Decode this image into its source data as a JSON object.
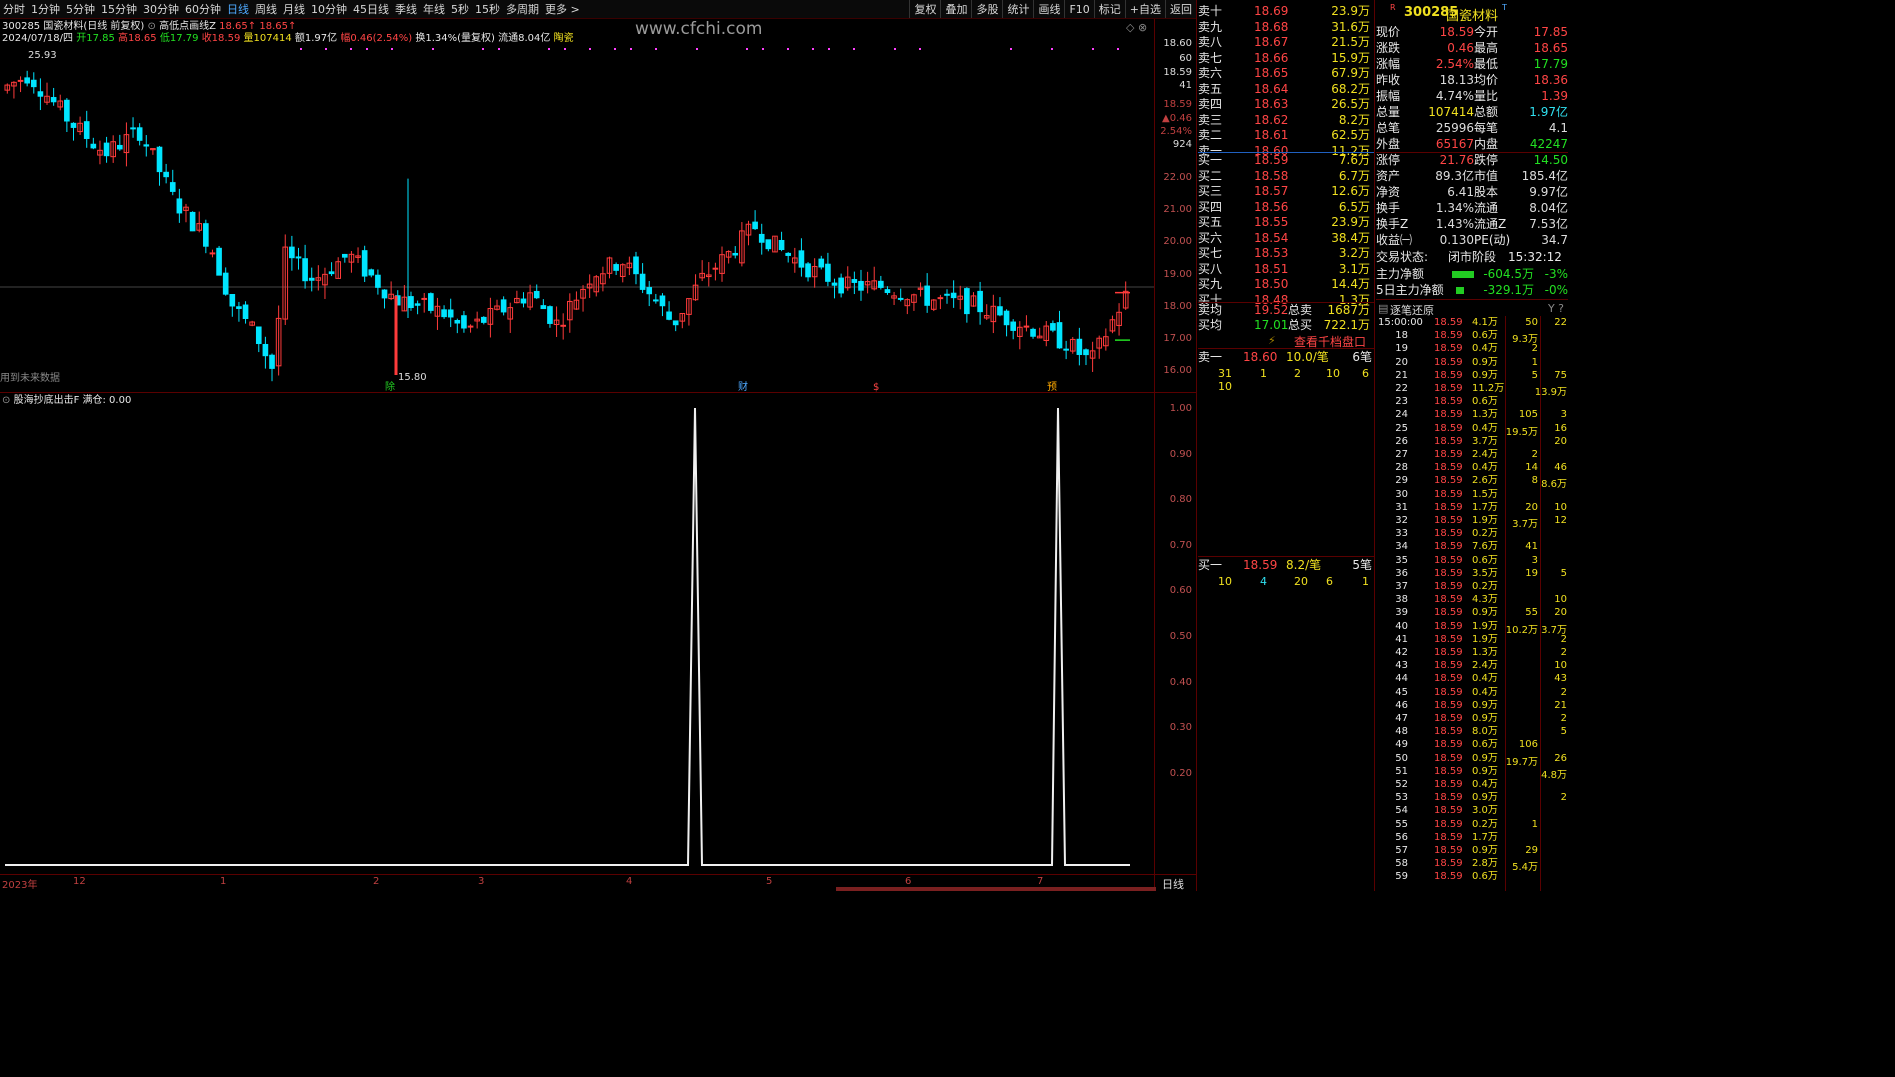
{
  "toolbar": {
    "periods": [
      "分时",
      "1分钟",
      "5分钟",
      "15分钟",
      "30分钟",
      "60分钟",
      "日线",
      "周线",
      "月线",
      "10分钟",
      "45日线",
      "季线",
      "年线",
      "5秒",
      "15秒",
      "多周期",
      "更多 >"
    ],
    "active": "日线",
    "right": [
      "复权",
      "叠加",
      "多股",
      "统计",
      "画线",
      "F10",
      "标记",
      "+自选",
      "返回"
    ]
  },
  "chart": {
    "title": "300285 国瓷材料(日线 前复权)",
    "indicator_name": "高低点画线Z",
    "ind_v1": "18.65↑",
    "ind_v2": "18.65↑",
    "date": "2024/07/18/四",
    "open_lbl": "开17.85",
    "high_lbl": "高18.65",
    "low_lbl": "低17.79",
    "close_lbl": "收18.59",
    "vol_lbl": "量107414",
    "amt_lbl": "额1.97亿",
    "chg_lbl": "幅0.46(2.54%)",
    "turn_lbl": "换1.34%(量复权)",
    "float_lbl": "流通8.04亿",
    "concept": "陶瓷",
    "watermark": "www.cfchi.com",
    "max_mark": "25.93",
    "min_mark": "15.80",
    "future_note": "用到未来数据",
    "events": [
      "除",
      "财",
      "$",
      "预"
    ],
    "price_axis": [
      "22.00",
      "21.00",
      "20.00",
      "19.00",
      "18.00",
      "17.00",
      "16.00"
    ],
    "side_axis": [
      "18.60",
      "60",
      "18.59",
      "41",
      "18.59",
      "▲0.46",
      "2.54%",
      "924"
    ],
    "dates": [
      "2023年",
      "12",
      "1",
      "2",
      "3",
      "4",
      "5",
      "6",
      "7"
    ],
    "period_tag": "日线"
  },
  "indicator": {
    "title": "股海抄底出击F 满仓: 0.00",
    "axis": [
      "1.00",
      "0.90",
      "0.80",
      "0.70",
      "0.60",
      "0.50",
      "0.40",
      "0.30",
      "0.20"
    ]
  },
  "orderbook": {
    "asks": [
      {
        "l": "卖十",
        "p": "18.69",
        "v": "23.9万"
      },
      {
        "l": "卖九",
        "p": "18.68",
        "v": "31.6万"
      },
      {
        "l": "卖八",
        "p": "18.67",
        "v": "21.5万"
      },
      {
        "l": "卖七",
        "p": "18.66",
        "v": "15.9万"
      },
      {
        "l": "卖六",
        "p": "18.65",
        "v": "67.9万"
      },
      {
        "l": "卖五",
        "p": "18.64",
        "v": "68.2万"
      },
      {
        "l": "卖四",
        "p": "18.63",
        "v": "26.5万"
      },
      {
        "l": "卖三",
        "p": "18.62",
        "v": "8.2万"
      },
      {
        "l": "卖二",
        "p": "18.61",
        "v": "62.5万"
      },
      {
        "l": "卖一",
        "p": "18.60",
        "v": "11.2万"
      }
    ],
    "bids": [
      {
        "l": "买一",
        "p": "18.59",
        "v": "7.6万"
      },
      {
        "l": "买二",
        "p": "18.58",
        "v": "6.7万"
      },
      {
        "l": "买三",
        "p": "18.57",
        "v": "12.6万"
      },
      {
        "l": "买四",
        "p": "18.56",
        "v": "6.5万"
      },
      {
        "l": "买五",
        "p": "18.55",
        "v": "23.9万"
      },
      {
        "l": "买六",
        "p": "18.54",
        "v": "38.4万"
      },
      {
        "l": "买七",
        "p": "18.53",
        "v": "3.2万"
      },
      {
        "l": "买八",
        "p": "18.51",
        "v": "3.1万"
      },
      {
        "l": "买九",
        "p": "18.50",
        "v": "14.4万"
      },
      {
        "l": "买十",
        "p": "18.48",
        "v": "1.3万"
      }
    ],
    "ask_avg_l": "卖均",
    "ask_avg": "19.52",
    "total_sell_l": "总卖",
    "total_sell": "1687万",
    "bid_avg_l": "买均",
    "bid_avg": "17.01",
    "total_buy_l": "总买",
    "total_buy": "722.1万",
    "view_1000": "查看千档盘口",
    "sell1": {
      "l": "卖一",
      "p": "18.60",
      "per": "10.0/笔",
      "cnt": "6笔",
      "q": [
        "31",
        "1",
        "2",
        "10",
        "6",
        "10"
      ]
    },
    "buy1": {
      "l": "买一",
      "p": "18.59",
      "per": "8.2/笔",
      "cnt": "5笔",
      "q": [
        "10",
        "4",
        "20",
        "6",
        "1"
      ]
    }
  },
  "quote": {
    "code": "300285",
    "name": "国瓷材料",
    "rows": [
      [
        "现价",
        "18.59",
        "今开",
        "17.85"
      ],
      [
        "涨跌",
        "0.46",
        "最高",
        "18.65"
      ],
      [
        "涨幅",
        "2.54%",
        "最低",
        "17.79"
      ],
      [
        "昨收",
        "18.13",
        "均价",
        "18.36"
      ],
      [
        "振幅",
        "4.74%",
        "量比",
        "1.39"
      ],
      [
        "总量",
        "107414",
        "总额",
        "1.97亿"
      ],
      [
        "总笔",
        "25996",
        "每笔",
        "4.1"
      ],
      [
        "外盘",
        "65167",
        "内盘",
        "42247"
      ],
      [
        "涨停",
        "21.76",
        "跌停",
        "14.50"
      ],
      [
        "资产",
        "89.3亿",
        "市值",
        "185.4亿"
      ],
      [
        "净资",
        "6.41",
        "股本",
        "9.97亿"
      ],
      [
        "换手",
        "1.34%",
        "流通",
        "8.04亿"
      ],
      [
        "换手Z",
        "1.43%",
        "流通Z",
        "7.53亿"
      ],
      [
        "收益㈠",
        "0.130",
        "PE(动)",
        "34.7"
      ]
    ],
    "status_l": "交易状态:",
    "status": "闭市阶段",
    "time": "15:32:12",
    "main_l": "主力净额",
    "main_v": "-604.5万",
    "main_p": "-3%",
    "main5_l": "5日主力净额",
    "main5_v": "-329.1万",
    "main5_p": "-0%"
  },
  "ticks": {
    "title": "逐笔还原",
    "rows": [
      [
        "15:00:00",
        "18.59",
        "4.1万"
      ],
      [
        "18",
        "18.59",
        "0.6万"
      ],
      [
        "19",
        "18.59",
        "0.4万"
      ],
      [
        "20",
        "18.59",
        "0.9万"
      ],
      [
        "21",
        "18.59",
        "0.9万"
      ],
      [
        "22",
        "18.59",
        "11.2万"
      ],
      [
        "23",
        "18.59",
        "0.6万"
      ],
      [
        "24",
        "18.59",
        "1.3万"
      ],
      [
        "25",
        "18.59",
        "0.4万"
      ],
      [
        "26",
        "18.59",
        "3.7万"
      ],
      [
        "27",
        "18.59",
        "2.4万"
      ],
      [
        "28",
        "18.59",
        "0.4万"
      ],
      [
        "29",
        "18.59",
        "2.6万"
      ],
      [
        "30",
        "18.59",
        "1.5万"
      ],
      [
        "31",
        "18.59",
        "1.7万"
      ],
      [
        "32",
        "18.59",
        "1.9万"
      ],
      [
        "33",
        "18.59",
        "0.2万"
      ],
      [
        "34",
        "18.59",
        "7.6万"
      ],
      [
        "35",
        "18.59",
        "0.6万"
      ],
      [
        "36",
        "18.59",
        "3.5万"
      ],
      [
        "37",
        "18.59",
        "0.2万"
      ],
      [
        "38",
        "18.59",
        "4.3万"
      ],
      [
        "39",
        "18.59",
        "0.9万"
      ],
      [
        "40",
        "18.59",
        "1.9万"
      ],
      [
        "41",
        "18.59",
        "1.9万"
      ],
      [
        "42",
        "18.59",
        "1.3万"
      ],
      [
        "43",
        "18.59",
        "2.4万"
      ],
      [
        "44",
        "18.59",
        "0.4万"
      ],
      [
        "45",
        "18.59",
        "0.4万"
      ],
      [
        "46",
        "18.59",
        "0.9万"
      ],
      [
        "47",
        "18.59",
        "0.9万"
      ],
      [
        "48",
        "18.59",
        "8.0万"
      ],
      [
        "49",
        "18.59",
        "0.6万"
      ],
      [
        "50",
        "18.59",
        "0.9万"
      ],
      [
        "51",
        "18.59",
        "0.9万"
      ],
      [
        "52",
        "18.59",
        "0.4万"
      ],
      [
        "53",
        "18.59",
        "0.9万"
      ],
      [
        "54",
        "18.59",
        "3.0万"
      ],
      [
        "55",
        "18.59",
        "0.2万"
      ],
      [
        "56",
        "18.59",
        "1.7万"
      ],
      [
        "57",
        "18.59",
        "0.9万"
      ],
      [
        "58",
        "18.59",
        "2.8万"
      ],
      [
        "59",
        "18.59",
        "0.6万"
      ]
    ],
    "mid": [
      [
        "50",
        "0"
      ],
      [
        "9.3万",
        "1"
      ],
      [
        "2",
        "2"
      ],
      [
        "1",
        "3"
      ],
      [
        "5",
        "4"
      ],
      [
        "105",
        "7"
      ],
      [
        "19.5万",
        "8"
      ],
      [
        "2",
        "10"
      ],
      [
        "14",
        "11"
      ],
      [
        "8",
        "12"
      ],
      [
        "20",
        "14"
      ],
      [
        "3.7万",
        "15"
      ],
      [
        "41",
        "17"
      ],
      [
        "3",
        "18"
      ],
      [
        "19",
        "19"
      ],
      [
        "55",
        "22"
      ],
      [
        "10.2万",
        "23"
      ],
      [
        "106",
        "32"
      ],
      [
        "19.7万",
        "33"
      ],
      [
        "1",
        "38"
      ],
      [
        "29",
        "40"
      ],
      [
        "5.4万",
        "41"
      ]
    ],
    "right": [
      [
        "22",
        "0"
      ],
      [
        "75",
        "4"
      ],
      [
        "13.9万",
        "5"
      ],
      [
        "3",
        "7"
      ],
      [
        "16",
        "8"
      ],
      [
        "20",
        "9"
      ],
      [
        "46",
        "11"
      ],
      [
        "8.6万",
        "12"
      ],
      [
        "10",
        "14"
      ],
      [
        "12",
        "15"
      ],
      [
        "5",
        "19"
      ],
      [
        "10",
        "21"
      ],
      [
        "20",
        "22"
      ],
      [
        "3.7万",
        "23"
      ],
      [
        "2",
        "24"
      ],
      [
        "2",
        "25"
      ],
      [
        "10",
        "26"
      ],
      [
        "43",
        "27"
      ],
      [
        "2",
        "28"
      ],
      [
        "21",
        "29"
      ],
      [
        "2",
        "30"
      ],
      [
        "5",
        "31"
      ],
      [
        "26",
        "33"
      ],
      [
        "4.8万",
        "34"
      ],
      [
        "2",
        "36"
      ]
    ]
  }
}
